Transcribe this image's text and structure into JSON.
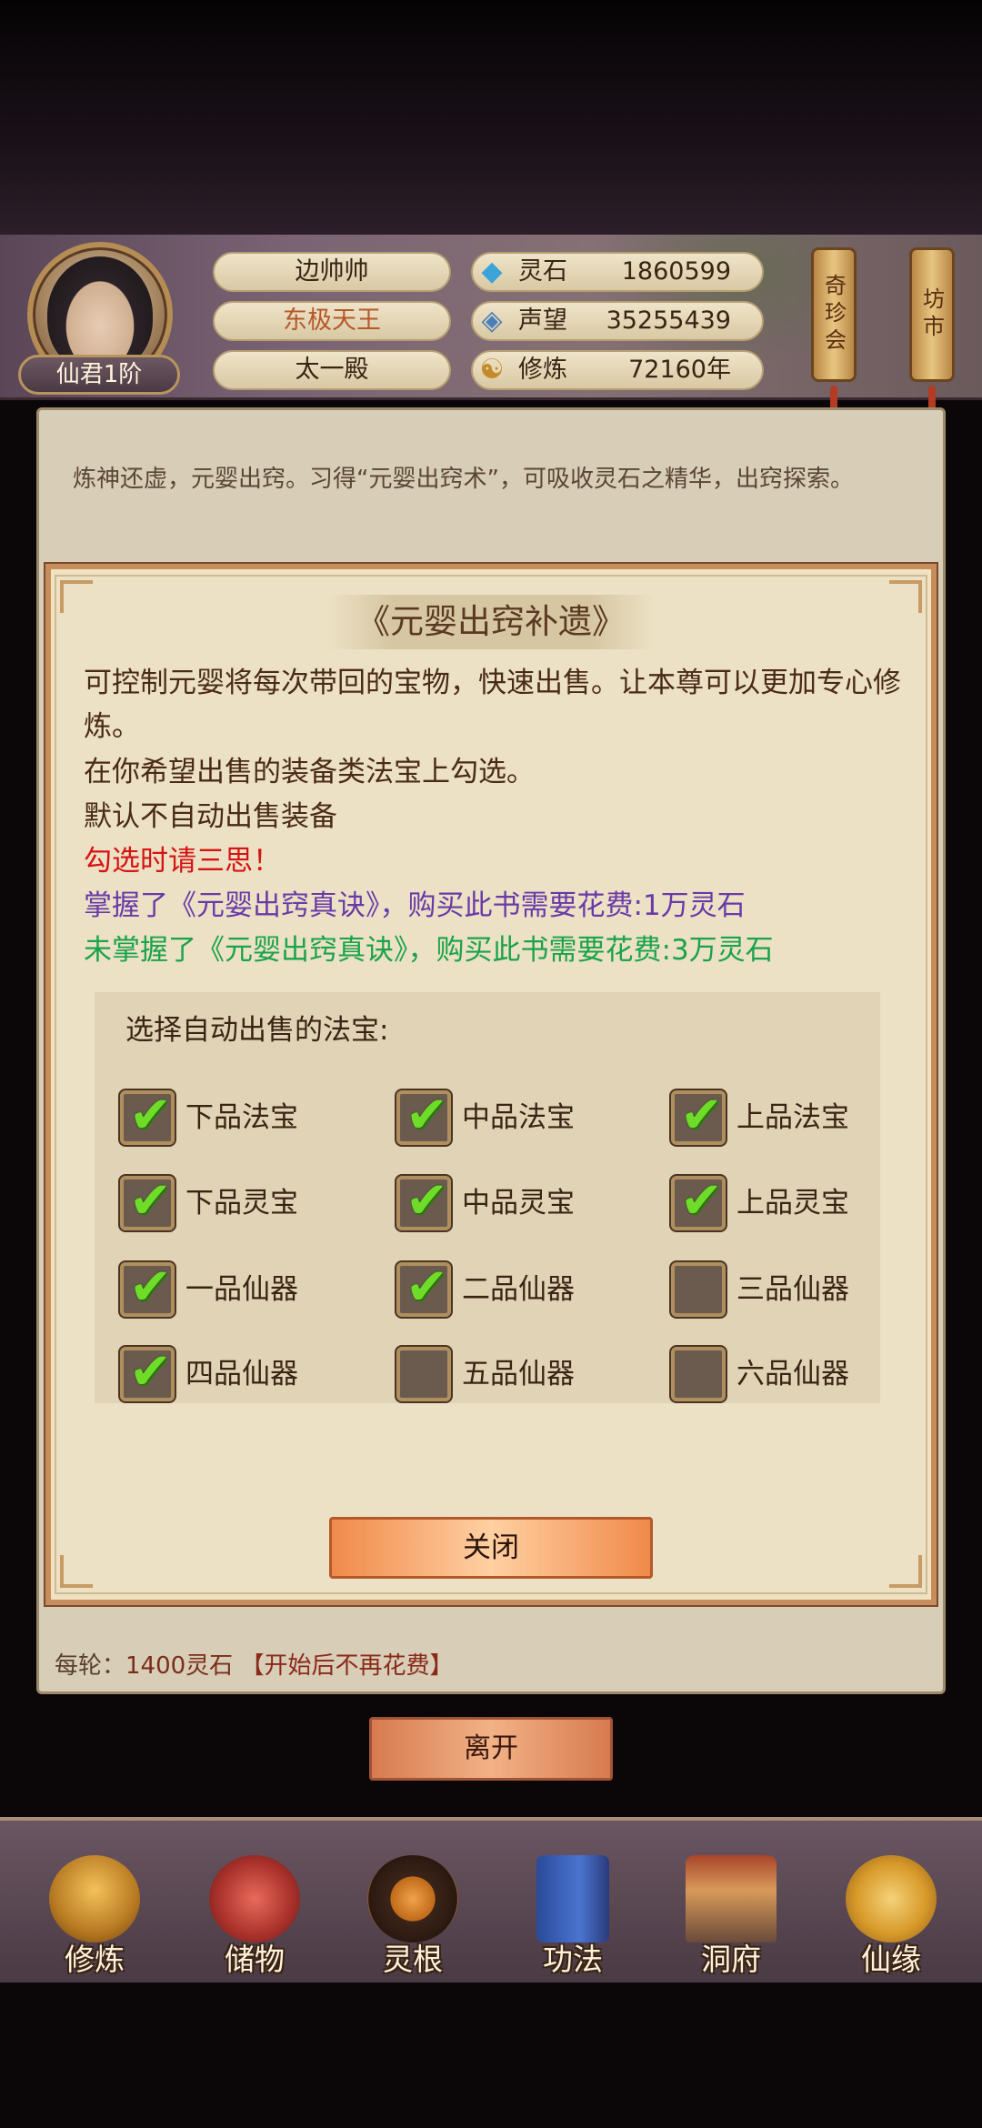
{
  "header": {
    "rank": "仙君1阶",
    "player_name": "边帅帅",
    "title": "东极天王",
    "sect": "太一殿",
    "stats": [
      {
        "label": "灵石",
        "value": "1860599",
        "icon": "spirit-stone-icon"
      },
      {
        "label": "声望",
        "value": "35255439",
        "icon": "reputation-icon"
      },
      {
        "label": "修炼",
        "value": "72160年",
        "icon": "cultivation-icon"
      }
    ],
    "side_buttons": [
      {
        "label": "奇珍会"
      },
      {
        "label": "坊市"
      }
    ]
  },
  "background": {
    "description": "炼神还虚，元婴出窍。习得“元婴出窍术”，可吸收灵石之精华，出窍探索。",
    "footer_label": "每轮：",
    "footer_cost": "1400灵石",
    "footer_note": "【开始后不再花费】",
    "leave_button": "离开"
  },
  "modal": {
    "title": "《元婴出窍补遗》",
    "lines": [
      "可控制元婴将每次带回的宝物，快速出售。让本尊可以更加专心修炼。",
      "在你希望出售的装备类法宝上勾选。",
      "默认不自动出售装备"
    ],
    "warning": "勾选时请三思！",
    "price_mastered": "掌握了《元婴出窍真诀》，购买此书需要花费:1万灵石",
    "price_unmastered": "未掌握了《元婴出窍真诀》，购买此书需要花费:3万灵石",
    "select_title": "选择自动出售的法宝:",
    "options": [
      {
        "label": "下品法宝",
        "checked": true
      },
      {
        "label": "中品法宝",
        "checked": true
      },
      {
        "label": "上品法宝",
        "checked": true
      },
      {
        "label": "下品灵宝",
        "checked": true
      },
      {
        "label": "中品灵宝",
        "checked": true
      },
      {
        "label": "上品灵宝",
        "checked": true
      },
      {
        "label": "一品仙器",
        "checked": true
      },
      {
        "label": "二品仙器",
        "checked": true
      },
      {
        "label": "三品仙器",
        "checked": false
      },
      {
        "label": "四品仙器",
        "checked": true
      },
      {
        "label": "五品仙器",
        "checked": false
      },
      {
        "label": "六品仙器",
        "checked": false
      }
    ],
    "close_button": "关闭",
    "check_glyph": "✔"
  },
  "nav": [
    {
      "label": "修炼",
      "icon": "cultivate-icon"
    },
    {
      "label": "储物",
      "icon": "storage-bag-icon"
    },
    {
      "label": "灵根",
      "icon": "spirit-root-icon"
    },
    {
      "label": "功法",
      "icon": "technique-book-icon"
    },
    {
      "label": "洞府",
      "icon": "cave-dwelling-icon"
    },
    {
      "label": "仙缘",
      "icon": "immortal-fate-icon"
    }
  ],
  "colors": {
    "warning": "#d51414",
    "mastered": "#6a3aa8",
    "unmastered": "#1aa34a",
    "check": "#6fdc2a"
  }
}
